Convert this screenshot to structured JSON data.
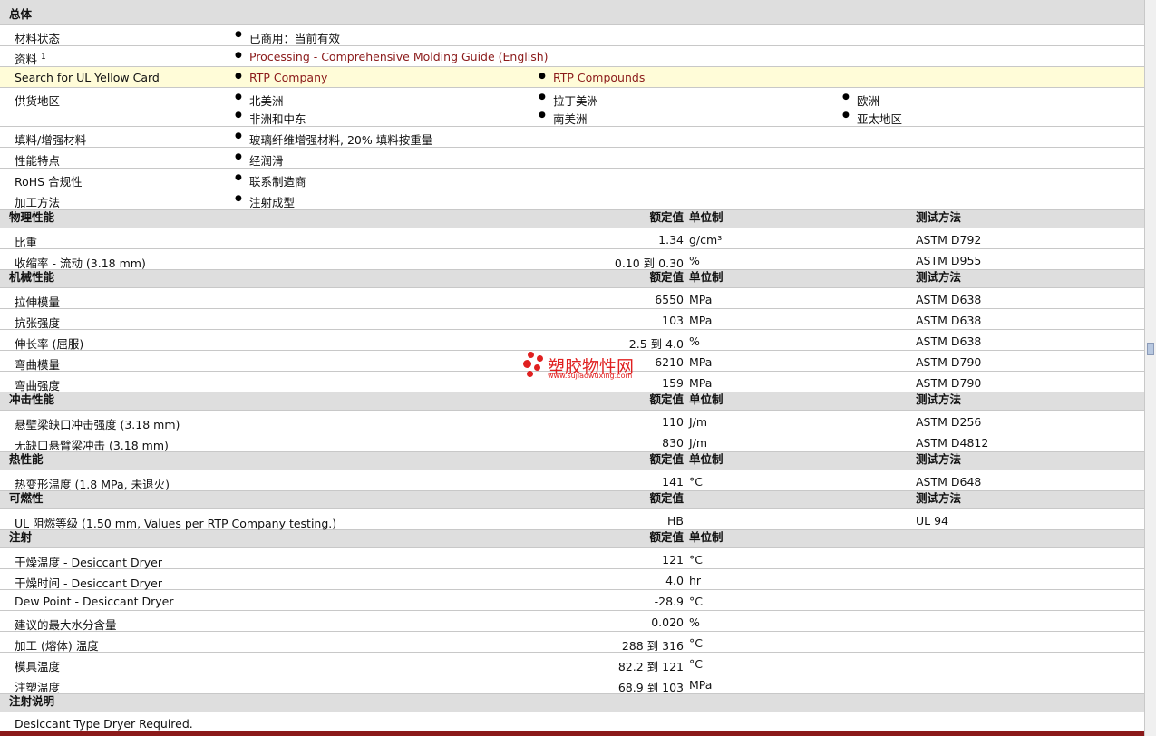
{
  "general": {
    "title": "总体",
    "status_label": "材料状态",
    "status_value": "已商用：当前有效",
    "docs_label": "资料",
    "docs_sup": "1",
    "docs_link": "Processing - Comprehensive Molding Guide (English)",
    "ul_label": "Search for UL Yellow Card",
    "ul_link1": "RTP Company",
    "ul_link2": "RTP Compounds",
    "region_label": "供货地区",
    "regions": [
      "北美洲",
      "拉丁美洲",
      "欧洲",
      "非洲和中东",
      "南美洲",
      "亚太地区"
    ],
    "filler_label": "填料/增强材料",
    "filler_value": "玻璃纤维增强材料, 20% 填料按重量",
    "feature_label": "性能特点",
    "feature_value": "经润滑",
    "rohs_label": "RoHS 合规性",
    "rohs_value": "联系制造商",
    "process_label": "加工方法",
    "process_value": "注射成型"
  },
  "headers": {
    "value": "额定值",
    "unit": "单位制",
    "method": "测试方法"
  },
  "sections": {
    "physical": "物理性能",
    "mechanical": "机械性能",
    "impact": "冲击性能",
    "thermal": "热性能",
    "flammability": "可燃性",
    "injection": "注射",
    "injection_notes": "注射说明"
  },
  "physical": [
    {
      "name": "比重",
      "value": "1.34",
      "unit": "g/cm³",
      "method": "ASTM D792"
    },
    {
      "name": "收缩率 - 流动 (3.18 mm)",
      "value": "0.10 到  0.30",
      "unit": "%",
      "method": "ASTM D955"
    }
  ],
  "mechanical": [
    {
      "name": "拉伸模量",
      "value": "6550",
      "unit": "MPa",
      "method": "ASTM D638"
    },
    {
      "name": "抗张强度",
      "value": "103",
      "unit": "MPa",
      "method": "ASTM D638"
    },
    {
      "name": "伸长率 (屈服)",
      "value": "2.5 到  4.0",
      "unit": "%",
      "method": "ASTM D638"
    },
    {
      "name": "弯曲模量",
      "value": "6210",
      "unit": "MPa",
      "method": "ASTM D790"
    },
    {
      "name": "弯曲强度",
      "value": "159",
      "unit": "MPa",
      "method": "ASTM D790"
    }
  ],
  "impact": [
    {
      "name": "悬壁梁缺口冲击强度 (3.18 mm)",
      "value": "110",
      "unit": "J/m",
      "method": "ASTM D256"
    },
    {
      "name": "无缺口悬臂梁冲击 (3.18 mm)",
      "value": "830",
      "unit": "J/m",
      "method": "ASTM D4812"
    }
  ],
  "thermal": [
    {
      "name": "热变形温度 (1.8 MPa, 未退火)",
      "value": "141",
      "unit": "°C",
      "method": "ASTM D648"
    }
  ],
  "flammability": [
    {
      "name": "UL 阻燃等级 (1.50 mm, Values per RTP Company testing.)",
      "value": "HB",
      "unit": "",
      "method": "UL 94"
    }
  ],
  "injection": [
    {
      "name": "干燥温度  - Desiccant Dryer",
      "value": "121",
      "unit": "°C",
      "method": ""
    },
    {
      "name": "干燥时间  - Desiccant Dryer",
      "value": "4.0",
      "unit": "hr",
      "method": ""
    },
    {
      "name": "Dew Point - Desiccant Dryer",
      "value": "-28.9",
      "unit": "°C",
      "method": ""
    },
    {
      "name": "建议的最大水分含量",
      "value": "0.020",
      "unit": "%",
      "method": ""
    },
    {
      "name": "加工 (熔体) 温度",
      "value": "288 到  316",
      "unit": "°C",
      "method": ""
    },
    {
      "name": "模具温度",
      "value": "82.2 到  121",
      "unit": "°C",
      "method": ""
    },
    {
      "name": "注塑温度",
      "value": "68.9 到  103",
      "unit": "MPa",
      "method": ""
    }
  ],
  "injection_note": "Desiccant Type Dryer Required.",
  "watermark": {
    "text": "塑胶物性网",
    "url": "www.sujiaowuxing.com"
  }
}
